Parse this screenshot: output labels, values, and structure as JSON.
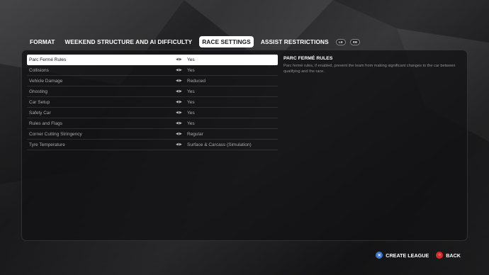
{
  "tabs": [
    {
      "label": "FORMAT"
    },
    {
      "label": "WEEKEND STRUCTURE AND AI DIFFICULTY"
    },
    {
      "label": "RACE SETTINGS"
    },
    {
      "label": "ASSIST RESTRICTIONS"
    }
  ],
  "active_tab": "RACE SETTINGS",
  "bumpers": {
    "left": "LB",
    "right": "RB"
  },
  "settings": [
    {
      "label": "Parc Fermé Rules",
      "value": "Yes"
    },
    {
      "label": "Collisions",
      "value": "Yes"
    },
    {
      "label": "Vehicle Damage",
      "value": "Reduced"
    },
    {
      "label": "Ghosting",
      "value": "Yes"
    },
    {
      "label": "Car Setup",
      "value": "Yes"
    },
    {
      "label": "Safety Car",
      "value": "Yes"
    },
    {
      "label": "Rules and Flags",
      "value": "Yes"
    },
    {
      "label": "Corner Cutting Stringency",
      "value": "Regular"
    },
    {
      "label": "Tyre Temperature",
      "value": "Surface & Carcass (Simulation)"
    }
  ],
  "selected_setting": "Parc Fermé Rules",
  "description": {
    "title": "PARC FERMÉ RULES",
    "body": "Parc fermé rules, if enabled, prevent the team from making significant changes to the car between qualifying and the race."
  },
  "footer": {
    "create_label": "CREATE LEAGUE",
    "create_icon": "cross-button-icon",
    "create_color": "#3a78d6",
    "back_label": "BACK",
    "back_icon": "circle-button-icon",
    "back_color": "#d62b2b"
  },
  "colors": {
    "accent": "#ffffff",
    "selected_text": "#15151e"
  }
}
